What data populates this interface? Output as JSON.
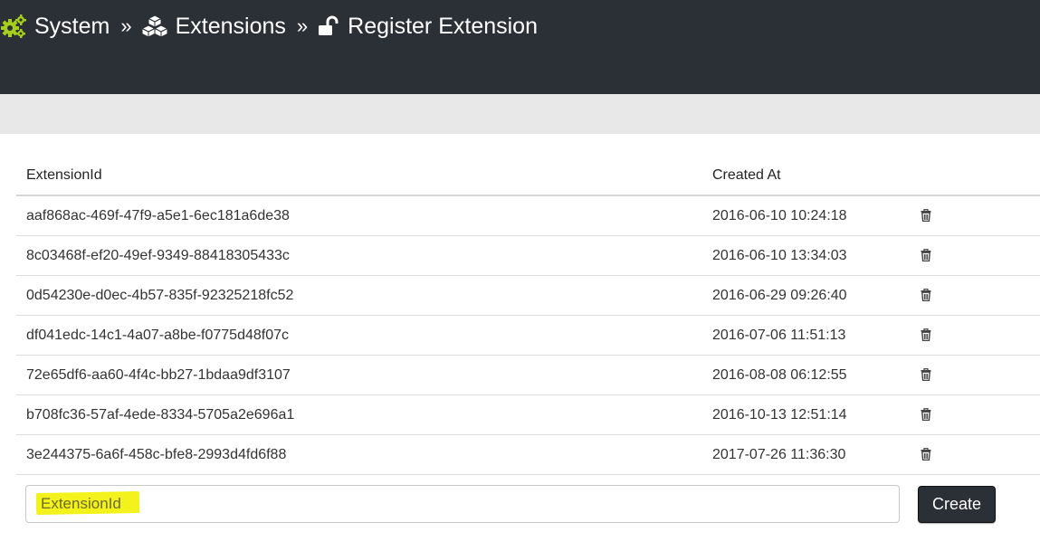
{
  "breadcrumb": [
    {
      "label": "System",
      "icon": "cogs-icon"
    },
    {
      "label": "Extensions",
      "icon": "cubes-icon"
    },
    {
      "label": "Register Extension",
      "icon": "unlock-icon"
    }
  ],
  "separator": "»",
  "colors": {
    "header_bg": "#2b2f36",
    "cog_accent": "#a6ce1c",
    "highlight": "#f3f21c",
    "band_bg": "#e8e8e8"
  },
  "table": {
    "headers": {
      "id": "ExtensionId",
      "created": "Created At"
    },
    "rows": [
      {
        "id": "aaf868ac-469f-47f9-a5e1-6ec181a6de38",
        "created": "2016-06-10 10:24:18"
      },
      {
        "id": "8c03468f-ef20-49ef-9349-88418305433c",
        "created": "2016-06-10 13:34:03"
      },
      {
        "id": "0d54230e-d0ec-4b57-835f-92325218fc52",
        "created": "2016-06-29 09:26:40"
      },
      {
        "id": "df041edc-14c1-4a07-a8be-f0775d48f07c",
        "created": "2016-07-06 11:51:13"
      },
      {
        "id": "72e65df6-aa60-4f4c-bb27-1bdaa9df3107",
        "created": "2016-08-08 06:12:55"
      },
      {
        "id": "b708fc36-57af-4ede-8334-5705a2e696a1",
        "created": "2016-10-13 12:51:14"
      },
      {
        "id": "3e244375-6a6f-458c-bfe8-2993d4fd6f88",
        "created": "2017-07-26 11:36:30"
      }
    ]
  },
  "form": {
    "input_placeholder": "ExtensionId",
    "input_value": "",
    "create_label": "Create"
  }
}
